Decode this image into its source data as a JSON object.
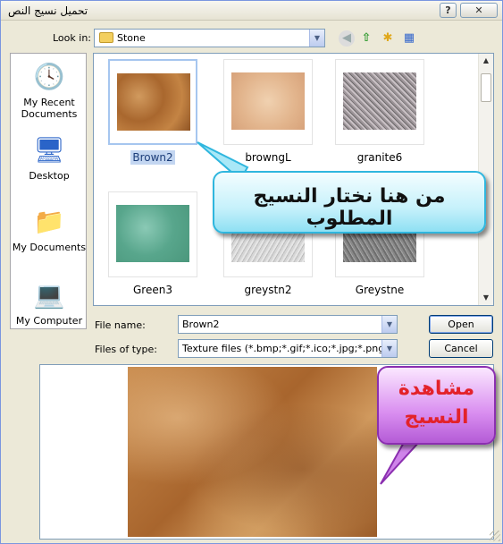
{
  "window": {
    "title": "تحميل نسيج النص",
    "help_label": "?",
    "close_label": "✕"
  },
  "toolbar": {
    "lookin_label": "Look in:",
    "lookin_value": "Stone",
    "back_icon": "back-arrow-icon",
    "up_icon": "up-folder-icon",
    "new_folder_icon": "new-folder-icon",
    "views_icon": "views-menu-icon"
  },
  "places": [
    {
      "label": "My Recent Documents",
      "icon": "recent-documents-icon"
    },
    {
      "label": "Desktop",
      "icon": "desktop-icon"
    },
    {
      "label": "My Documents",
      "icon": "my-documents-icon"
    },
    {
      "label": "My Computer",
      "icon": "my-computer-icon"
    }
  ],
  "files": [
    {
      "name": "Brown2",
      "selected": true
    },
    {
      "name": "browngL",
      "selected": false
    },
    {
      "name": "granite6",
      "selected": false
    },
    {
      "name": "Green3",
      "selected": false
    },
    {
      "name": "greystn2",
      "selected": false
    },
    {
      "name": "Greystne",
      "selected": false
    }
  ],
  "form": {
    "filename_label": "File name:",
    "filename_value": "Brown2",
    "filetype_label": "Files of type:",
    "filetype_value": "Texture files (*.bmp;*.gif;*.ico;*.jpg;*.png)",
    "open_label": "Open",
    "cancel_label": "Cancel"
  },
  "annotations": {
    "select_texture": "من هنا نختار النسيج المطلوب",
    "preview_line1": "مشاهدة",
    "preview_line2": "النسيج"
  },
  "colors": {
    "selection": "#c3d6f1",
    "callout_cyan": "#8fe0f3",
    "callout_purple": "#b45bd6",
    "callout_red_text": "#e3222a"
  }
}
